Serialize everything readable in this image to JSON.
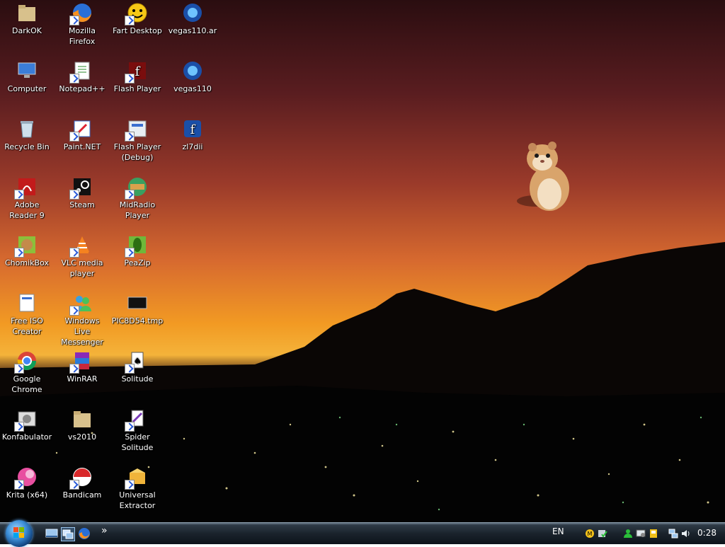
{
  "desktop": {
    "icons": [
      {
        "label": "DarkOK",
        "icon": "folder-icon"
      },
      {
        "label": "Mozilla Firefox",
        "icon": "firefox-icon"
      },
      {
        "label": "Fart Desktop",
        "icon": "smiley-icon"
      },
      {
        "label": "vegas110.ar",
        "icon": "vegas-icon"
      },
      {
        "label": "Computer",
        "icon": "computer-icon"
      },
      {
        "label": "Notepad++",
        "icon": "notepadpp-icon"
      },
      {
        "label": "Flash Player",
        "icon": "flash-icon"
      },
      {
        "label": "vegas110",
        "icon": "vegas-icon"
      },
      {
        "label": "Recycle Bin",
        "icon": "recycle-bin-icon"
      },
      {
        "label": "Paint.NET",
        "icon": "paintnet-icon"
      },
      {
        "label": "Flash Player (Debug)",
        "icon": "flash-debug-icon"
      },
      {
        "label": "zl7dii",
        "icon": "flash-file-icon"
      },
      {
        "label": "Adobe Reader 9",
        "icon": "adobe-reader-icon"
      },
      {
        "label": "Steam",
        "icon": "steam-icon"
      },
      {
        "label": "MidRadio Player",
        "icon": "midradio-icon"
      },
      {
        "label": "ChomikBox",
        "icon": "chomikbox-icon"
      },
      {
        "label": "VLC media player",
        "icon": "vlc-icon"
      },
      {
        "label": "PeaZip",
        "icon": "peazip-icon"
      },
      {
        "label": "Free ISO Creator",
        "icon": "iso-creator-icon"
      },
      {
        "label": "Windows Live Messenger",
        "icon": "messenger-icon"
      },
      {
        "label": "PIC8D54.tmp",
        "icon": "tmp-file-icon"
      },
      {
        "label": "Google Chrome",
        "icon": "chrome-icon"
      },
      {
        "label": "WinRAR",
        "icon": "winrar-icon"
      },
      {
        "label": "Solitude",
        "icon": "solitaire-icon"
      },
      {
        "label": "Konfabulator",
        "icon": "konfabulator-icon"
      },
      {
        "label": "vs2010",
        "icon": "folder-icon"
      },
      {
        "label": "Spider Solitude",
        "icon": "spider-solitaire-icon"
      },
      {
        "label": "Krita (x64)",
        "icon": "krita-icon"
      },
      {
        "label": "Bandicam",
        "icon": "bandicam-icon"
      },
      {
        "label": "Universal Extractor",
        "icon": "universal-extractor-icon"
      }
    ]
  },
  "taskbar": {
    "language": "EN",
    "clock": "0:28",
    "overflow_chevron": "»",
    "quick_launch": [
      "show-desktop-icon",
      "switch-windows-icon",
      "firefox-icon"
    ],
    "tray_icons": [
      "network-tray-icon",
      "messenger-tray-icon",
      "device-tray-icon",
      "security-tray-icon",
      "monitor-tray-icon",
      "volume-icon"
    ]
  }
}
